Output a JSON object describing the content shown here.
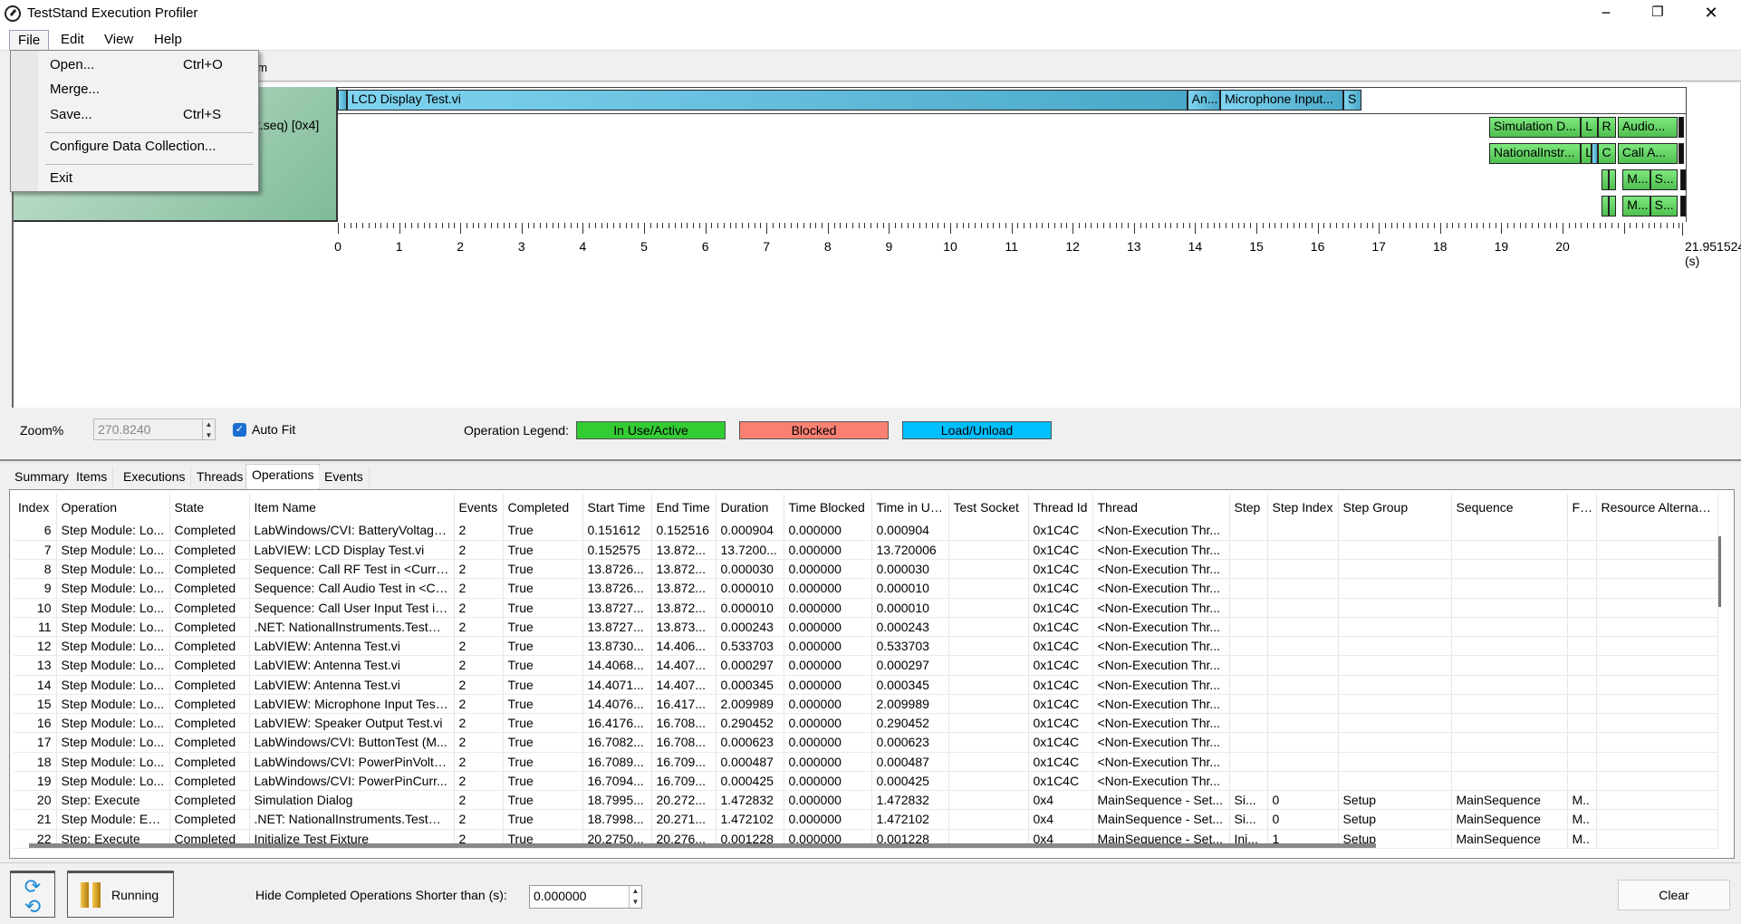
{
  "window": {
    "title": "TestStand Execution Profiler",
    "minimize": "−",
    "restore": "❐",
    "close": "✕"
  },
  "menu": {
    "items": [
      "File",
      "Edit",
      "View",
      "Help"
    ],
    "file_dropdown": [
      {
        "label": "Open...",
        "shortcut": "Ctrl+O"
      },
      {
        "label": "Merge...",
        "shortcut": ""
      },
      {
        "label": "Save...",
        "shortcut": "Ctrl+S"
      },
      {
        "label": "Configure Data Collection...",
        "shortcut": ""
      },
      {
        "label": "Exit",
        "shortcut": ""
      }
    ]
  },
  "timeline": {
    "partial_tab": "em",
    "row_label": "t.seq) [0x4]",
    "axis_end_label": "21.951524 (s)",
    "axis_max": 21.951524,
    "axis_ticks": [
      0,
      1,
      2,
      3,
      4,
      5,
      6,
      7,
      8,
      9,
      10,
      11,
      12,
      13,
      14,
      15,
      16,
      17,
      18,
      19,
      20
    ],
    "colors": {
      "in_use": "#33cc33",
      "blocked": "#fa8072",
      "load": "#00bfff"
    },
    "rows": [
      [
        {
          "s": 0,
          "e": 0.145,
          "t": "",
          "k": "blue"
        },
        {
          "s": 0.145,
          "e": 13.87,
          "t": "LCD Display Test.vi",
          "k": "blue"
        },
        {
          "s": 13.87,
          "e": 14.41,
          "t": "An...",
          "k": "blue"
        },
        {
          "s": 14.41,
          "e": 16.42,
          "t": "Microphone  Input...",
          "k": "blue"
        },
        {
          "s": 16.42,
          "e": 16.71,
          "t": "S",
          "k": "blue"
        }
      ],
      [
        {
          "s": 18.8,
          "e": 20.3,
          "t": "Simulation D...",
          "k": "green"
        },
        {
          "s": 20.3,
          "e": 20.57,
          "t": "L",
          "k": "green"
        },
        {
          "s": 20.57,
          "e": 20.88,
          "t": "R",
          "k": "green"
        },
        {
          "s": 20.9,
          "e": 21.88,
          "t": "Audio...",
          "k": "green"
        },
        {
          "s": 21.9,
          "e": 21.95,
          "t": "",
          "k": "black"
        }
      ],
      [
        {
          "s": 18.8,
          "e": 20.3,
          "t": "NationalInstr...",
          "k": "green"
        },
        {
          "s": 20.3,
          "e": 20.48,
          "t": "L",
          "k": "green"
        },
        {
          "s": 20.48,
          "e": 20.57,
          "t": "",
          "k": "blue"
        },
        {
          "s": 20.57,
          "e": 20.88,
          "t": "C",
          "k": "green"
        },
        {
          "s": 20.9,
          "e": 21.88,
          "t": "Call A...",
          "k": "green"
        },
        {
          "s": 21.9,
          "e": 21.95,
          "t": "",
          "k": "black"
        }
      ],
      [
        {
          "s": 20.63,
          "e": 20.75,
          "t": "",
          "k": "green"
        },
        {
          "s": 20.75,
          "e": 20.88,
          "t": "",
          "k": "green"
        },
        {
          "s": 20.98,
          "e": 21.43,
          "t": "M...",
          "k": "green"
        },
        {
          "s": 21.43,
          "e": 21.88,
          "t": "S...",
          "k": "green"
        },
        {
          "s": 21.92,
          "e": 21.95,
          "t": "",
          "k": "black"
        }
      ],
      [
        {
          "s": 20.63,
          "e": 20.75,
          "t": "",
          "k": "green"
        },
        {
          "s": 20.75,
          "e": 20.88,
          "t": "",
          "k": "green"
        },
        {
          "s": 20.98,
          "e": 21.43,
          "t": "M...",
          "k": "green"
        },
        {
          "s": 21.43,
          "e": 21.88,
          "t": "S...",
          "k": "green"
        },
        {
          "s": 21.92,
          "e": 21.95,
          "t": "",
          "k": "black"
        }
      ]
    ]
  },
  "controls": {
    "zoom_label": "Zoom%",
    "zoom_value": "270.8240",
    "autofit_label": "Auto Fit",
    "autofit_checked": true,
    "legend_label": "Operation Legend:",
    "legend": [
      "In Use/Active",
      "Blocked",
      "Load/Unload"
    ]
  },
  "tabs": [
    "Summary",
    "Items",
    "Executions",
    "Threads",
    "Operations",
    "Events"
  ],
  "active_tab": "Operations",
  "table": {
    "columns": [
      "Index",
      "Operation",
      "State",
      "Item Name",
      "Events",
      "Completed",
      "Start Time",
      "End Time",
      "Duration",
      "Time Blocked",
      "Time in Use",
      "Test Socket",
      "Thread Id",
      "Thread",
      "Step",
      "Step Index",
      "Step Group",
      "Sequence",
      "File",
      "Resource Alternative"
    ],
    "rows": [
      [
        "6",
        "Step Module: Lo...",
        "Completed",
        "LabWindows/CVI: BatteryVoltage...",
        "2",
        "True",
        "0.151612",
        "0.152516",
        "0.000904",
        "0.000000",
        "0.000904",
        "",
        "0x1C4C",
        "<Non-Execution Thr...",
        "",
        "",
        "",
        "",
        "",
        ""
      ],
      [
        "7",
        "Step Module: Lo...",
        "Completed",
        "LabVIEW: LCD Display Test.vi",
        "2",
        "True",
        "0.152575",
        "13.872...",
        "13.7200...",
        "0.000000",
        "13.720006",
        "",
        "0x1C4C",
        "<Non-Execution Thr...",
        "",
        "",
        "",
        "",
        "",
        ""
      ],
      [
        "8",
        "Step Module: Lo...",
        "Completed",
        "Sequence: Call RF Test in <Curre...",
        "2",
        "True",
        "13.8726...",
        "13.872...",
        "0.000030",
        "0.000000",
        "0.000030",
        "",
        "0x1C4C",
        "<Non-Execution Thr...",
        "",
        "",
        "",
        "",
        "",
        ""
      ],
      [
        "9",
        "Step Module: Lo...",
        "Completed",
        "Sequence: Call Audio Test in <Cu...",
        "2",
        "True",
        "13.8726...",
        "13.872...",
        "0.000010",
        "0.000000",
        "0.000010",
        "",
        "0x1C4C",
        "<Non-Execution Thr...",
        "",
        "",
        "",
        "",
        "",
        ""
      ],
      [
        "10",
        "Step Module: Lo...",
        "Completed",
        "Sequence: Call User Input Test in...",
        "2",
        "True",
        "13.8727...",
        "13.872...",
        "0.000010",
        "0.000000",
        "0.000010",
        "",
        "0x1C4C",
        "<Non-Execution Thr...",
        "",
        "",
        "",
        "",
        "",
        ""
      ],
      [
        "11",
        "Step Module: Lo...",
        "Completed",
        ".NET: NationalInstruments.TestSt...",
        "2",
        "True",
        "13.8727...",
        "13.873...",
        "0.000243",
        "0.000000",
        "0.000243",
        "",
        "0x1C4C",
        "<Non-Execution Thr...",
        "",
        "",
        "",
        "",
        "",
        ""
      ],
      [
        "12",
        "Step Module: Lo...",
        "Completed",
        "LabVIEW: Antenna Test.vi",
        "2",
        "True",
        "13.8730...",
        "14.406...",
        "0.533703",
        "0.000000",
        "0.533703",
        "",
        "0x1C4C",
        "<Non-Execution Thr...",
        "",
        "",
        "",
        "",
        "",
        ""
      ],
      [
        "13",
        "Step Module: Lo...",
        "Completed",
        "LabVIEW: Antenna Test.vi",
        "2",
        "True",
        "14.4068...",
        "14.407...",
        "0.000297",
        "0.000000",
        "0.000297",
        "",
        "0x1C4C",
        "<Non-Execution Thr...",
        "",
        "",
        "",
        "",
        "",
        ""
      ],
      [
        "14",
        "Step Module: Lo...",
        "Completed",
        "LabVIEW: Antenna Test.vi",
        "2",
        "True",
        "14.4071...",
        "14.407...",
        "0.000345",
        "0.000000",
        "0.000345",
        "",
        "0x1C4C",
        "<Non-Execution Thr...",
        "",
        "",
        "",
        "",
        "",
        ""
      ],
      [
        "15",
        "Step Module: Lo...",
        "Completed",
        "LabVIEW: Microphone Input Test...",
        "2",
        "True",
        "14.4076...",
        "16.417...",
        "2.009989",
        "0.000000",
        "2.009989",
        "",
        "0x1C4C",
        "<Non-Execution Thr...",
        "",
        "",
        "",
        "",
        "",
        ""
      ],
      [
        "16",
        "Step Module: Lo...",
        "Completed",
        "LabVIEW: Speaker Output Test.vi",
        "2",
        "True",
        "16.4176...",
        "16.708...",
        "0.290452",
        "0.000000",
        "0.290452",
        "",
        "0x1C4C",
        "<Non-Execution Thr...",
        "",
        "",
        "",
        "",
        "",
        ""
      ],
      [
        "17",
        "Step Module: Lo...",
        "Completed",
        "LabWindows/CVI: ButtonTest (M...",
        "2",
        "True",
        "16.7082...",
        "16.708...",
        "0.000623",
        "0.000000",
        "0.000623",
        "",
        "0x1C4C",
        "<Non-Execution Thr...",
        "",
        "",
        "",
        "",
        "",
        ""
      ],
      [
        "18",
        "Step Module: Lo...",
        "Completed",
        "LabWindows/CVI: PowerPinVolta...",
        "2",
        "True",
        "16.7089...",
        "16.709...",
        "0.000487",
        "0.000000",
        "0.000487",
        "",
        "0x1C4C",
        "<Non-Execution Thr...",
        "",
        "",
        "",
        "",
        "",
        ""
      ],
      [
        "19",
        "Step Module: Lo...",
        "Completed",
        "LabWindows/CVI: PowerPinCurr...",
        "2",
        "True",
        "16.7094...",
        "16.709...",
        "0.000425",
        "0.000000",
        "0.000425",
        "",
        "0x1C4C",
        "<Non-Execution Thr...",
        "",
        "",
        "",
        "",
        "",
        ""
      ],
      [
        "20",
        "Step: Execute",
        "Completed",
        "Simulation Dialog",
        "2",
        "True",
        "18.7995...",
        "20.272...",
        "1.472832",
        "0.000000",
        "1.472832",
        "",
        "0x4",
        "MainSequence - Set...",
        "Si...",
        "0",
        "Setup",
        "MainSequence",
        "M..",
        ""
      ],
      [
        "21",
        "Step Module: Ex...",
        "Completed",
        ".NET: NationalInstruments.TestSt...",
        "2",
        "True",
        "18.7998...",
        "20.271...",
        "1.472102",
        "0.000000",
        "1.472102",
        "",
        "0x4",
        "MainSequence - Set...",
        "Si...",
        "0",
        "Setup",
        "MainSequence",
        "M..",
        ""
      ],
      [
        "22",
        "Step: Execute",
        "Completed",
        "Initialize Test Fixture",
        "2",
        "True",
        "20.2750...",
        "20.276...",
        "0.001228",
        "0.000000",
        "0.001228",
        "",
        "0x4",
        "MainSequence - Set...",
        "Ini...",
        "1",
        "Setup",
        "MainSequence",
        "M..",
        ""
      ]
    ]
  },
  "bottom": {
    "running_label": "Running",
    "hide_label": "Hide Completed Operations Shorter than (s):",
    "hide_value": "0.000000",
    "clear_label": "Clear"
  }
}
